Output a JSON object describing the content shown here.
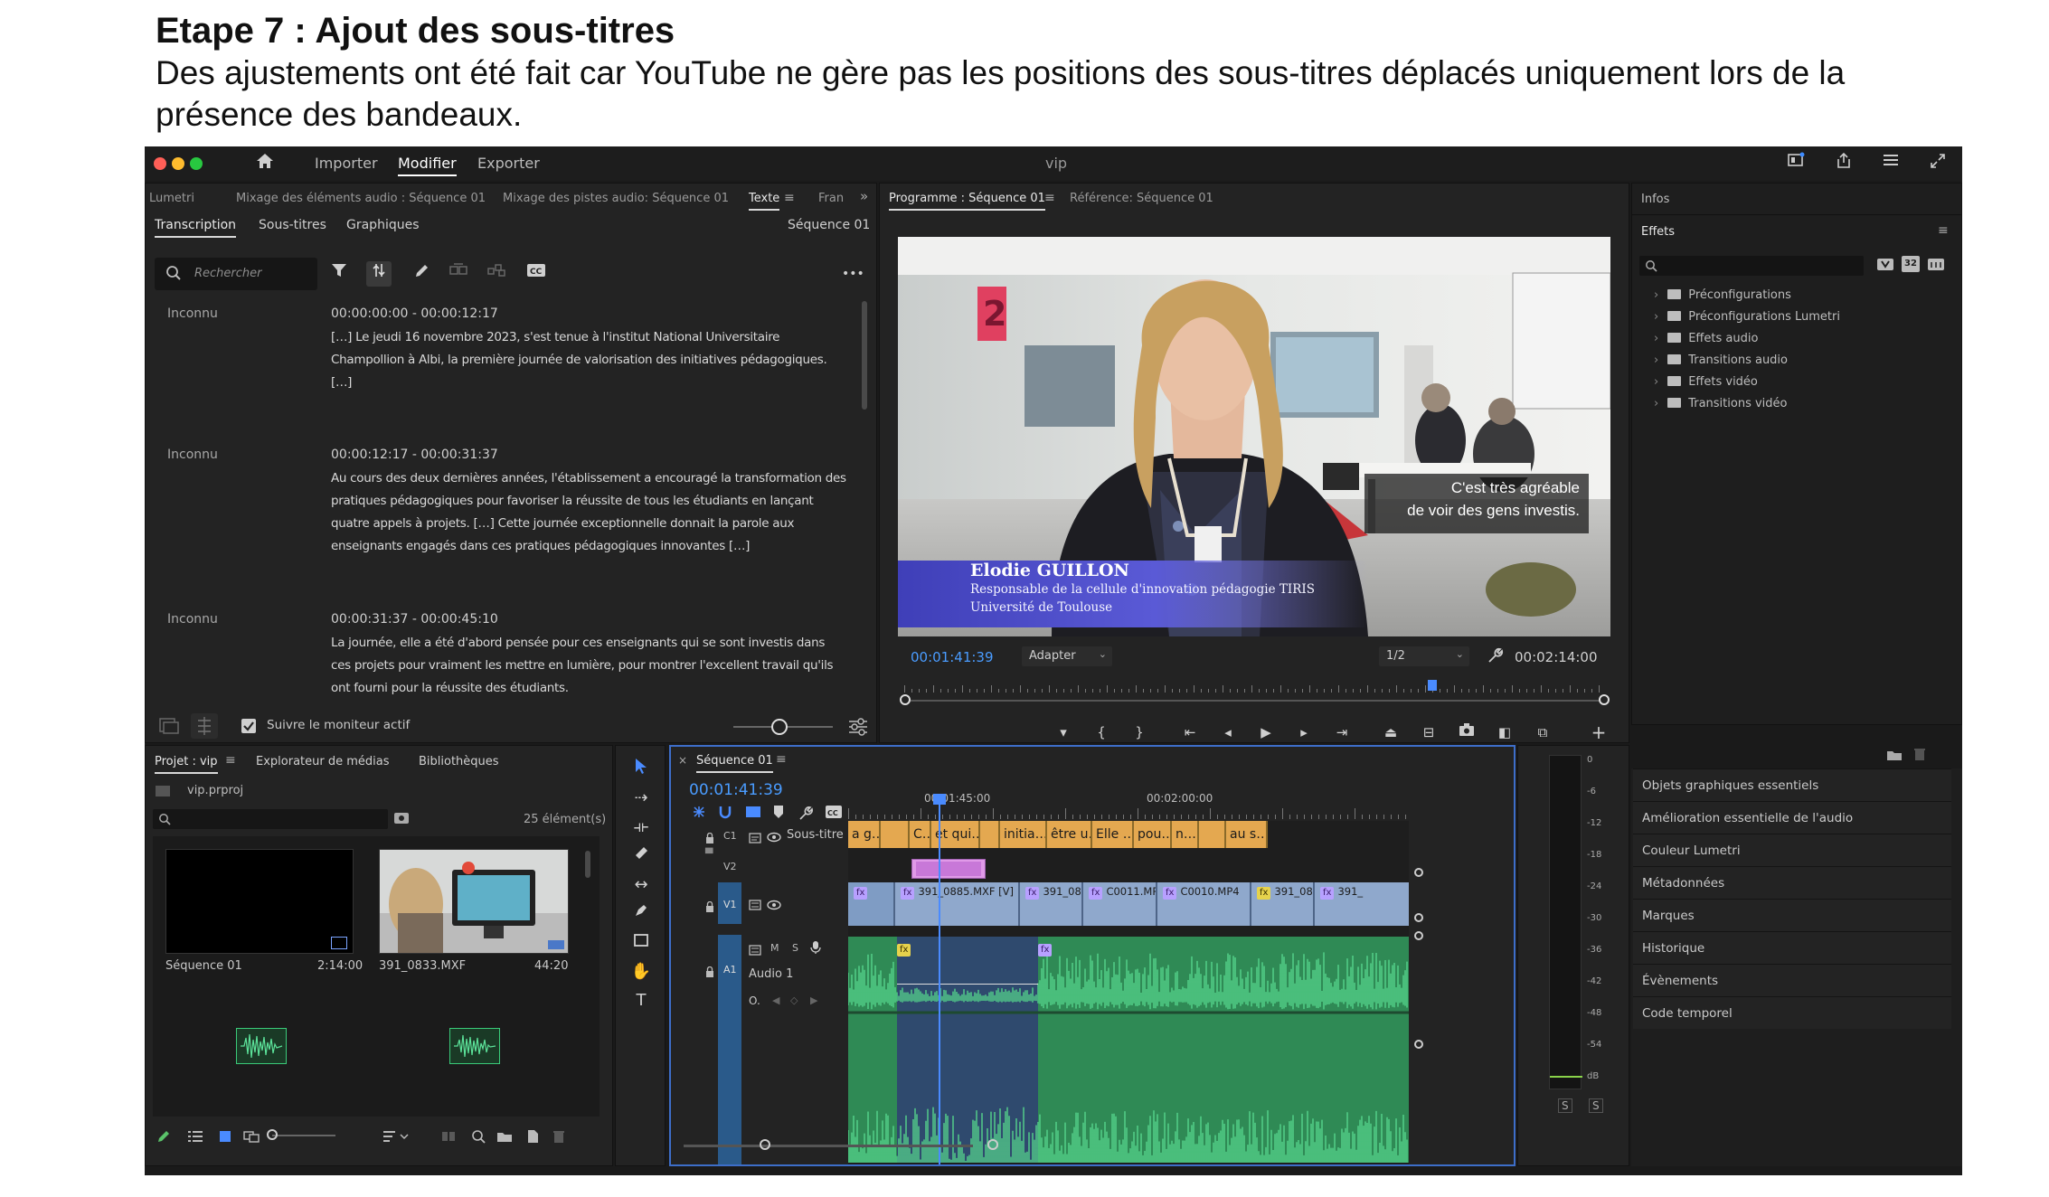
{
  "doc": {
    "title": "Etape 7 : Ajout des sous-titres",
    "body": "Des ajustements ont été fait car YouTube ne gère pas les positions des sous-titres déplacés uniquement lors de la présence des bandeaux."
  },
  "window": {
    "title": "vip",
    "nav": {
      "import": "Importer",
      "edit": "Modifier",
      "export": "Exporter"
    }
  },
  "left_panel": {
    "tabs": [
      "Lumetri",
      "Mixage des éléments audio : Séquence 01",
      "Mixage des pistes audio: Séquence 01",
      "Texte",
      "Fran"
    ],
    "subtabs": [
      "Transcription",
      "Sous-titres",
      "Graphiques"
    ],
    "sequence": "Séquence 01",
    "search_placeholder": "Rechercher",
    "more": "•••",
    "entries": [
      {
        "speaker": "Inconnu",
        "time": "00:00:00:00 - 00:00:12:17",
        "text": "[…] Le jeudi 16 novembre 2023, s'est tenue à l'institut National Universitaire Champollion à Albi, la première journée de valorisation des initiatives pédagogiques. […]"
      },
      {
        "speaker": "Inconnu",
        "time": "00:00:12:17 - 00:00:31:37",
        "text": "Au cours des deux dernières années, l'établissement a encouragé la transformation des pratiques pédagogiques pour favoriser la réussite de tous les étudiants en lançant quatre appels à projets. […] Cette journée exceptionnelle donnait la parole aux enseignants engagés dans ces pratiques pédagogiques innovantes […]"
      },
      {
        "speaker": "Inconnu",
        "time": "00:00:31:37 - 00:00:45:10",
        "text": "La journée, elle a été d'abord pensée pour ces enseignants qui se sont investis dans ces projets pour vraiment les mettre en lumière, pour montrer l'excellent travail qu'ils ont fourni pour la réussite des étudiants."
      }
    ],
    "follow_monitor": "Suivre le moniteur actif",
    "follow_checked": true
  },
  "program": {
    "tab": "Programme : Séquence 01",
    "ref_tab": "Référence: Séquence 01",
    "timecode": "00:01:41:39",
    "fit": "Adapter",
    "resolution": "1/2",
    "duration": "00:02:14:00",
    "playhead_fraction": 0.755,
    "subtitle_line1": "C'est très agréable",
    "subtitle_line2": "de voir des gens investis.",
    "lower_third_name": "Elodie GUILLON",
    "lower_third_role": "Responsable de la cellule d'innovation pédagogie TIRIS",
    "lower_third_org": "Université de Toulouse",
    "sign_number": "2"
  },
  "right_panel": {
    "info_tab": "Infos",
    "effects_tab": "Effets",
    "effects": [
      "Préconfigurations",
      "Préconfigurations Lumetri",
      "Effets audio",
      "Transitions audio",
      "Effets vidéo",
      "Transitions vidéo"
    ],
    "sections": [
      "Objets graphiques essentiels",
      "Amélioration essentielle de l'audio",
      "Couleur Lumetri",
      "Métadonnées",
      "Marques",
      "Historique",
      "Évènements",
      "Code temporel"
    ],
    "btn_32": "32"
  },
  "project": {
    "tabs": [
      "Projet : vip",
      "Explorateur de médias",
      "Bibliothèques"
    ],
    "file": "vip.prproj",
    "count": "25 élément(s)",
    "items": [
      {
        "name": "Séquence 01",
        "duration": "2:14:00"
      },
      {
        "name": "391_0833.MXF",
        "duration": "44:20"
      }
    ]
  },
  "timeline": {
    "tab": "Séquence 01",
    "timecode": "00:01:41:39",
    "ruler": [
      "00:01:45:00",
      "00:02:00:00"
    ],
    "tracks": {
      "c1_label": "C1",
      "c1_name": "Sous-titre",
      "v2": "V2",
      "v1": "V1",
      "a1": "A1",
      "a1_name": "Audio 1",
      "o_label": "O."
    },
    "captions": [
      "a g…",
      "C…",
      "et qui…",
      "initia…",
      "être u…",
      "Elle …",
      "pou…",
      "n…",
      "au s…"
    ],
    "video_clips": [
      "391_0885.MXF [V]",
      "391_085",
      "C0011.MP",
      "C0010.MP4",
      "391_08",
      "391_"
    ],
    "fx_label": "fx"
  },
  "meter": {
    "scale": [
      "0",
      "-6",
      "-12",
      "-18",
      "-24",
      "-30",
      "-36",
      "-42",
      "-48",
      "-54",
      "dB"
    ],
    "solo": [
      "S",
      "S"
    ]
  },
  "colors": {
    "caption_clip": "#e4a850",
    "video_clip": "#8fa8cc",
    "audio_clip": "#2f8a55",
    "waveform": "#55d58c",
    "playhead": "#4a8bff",
    "selection": "#3d6ec9"
  }
}
